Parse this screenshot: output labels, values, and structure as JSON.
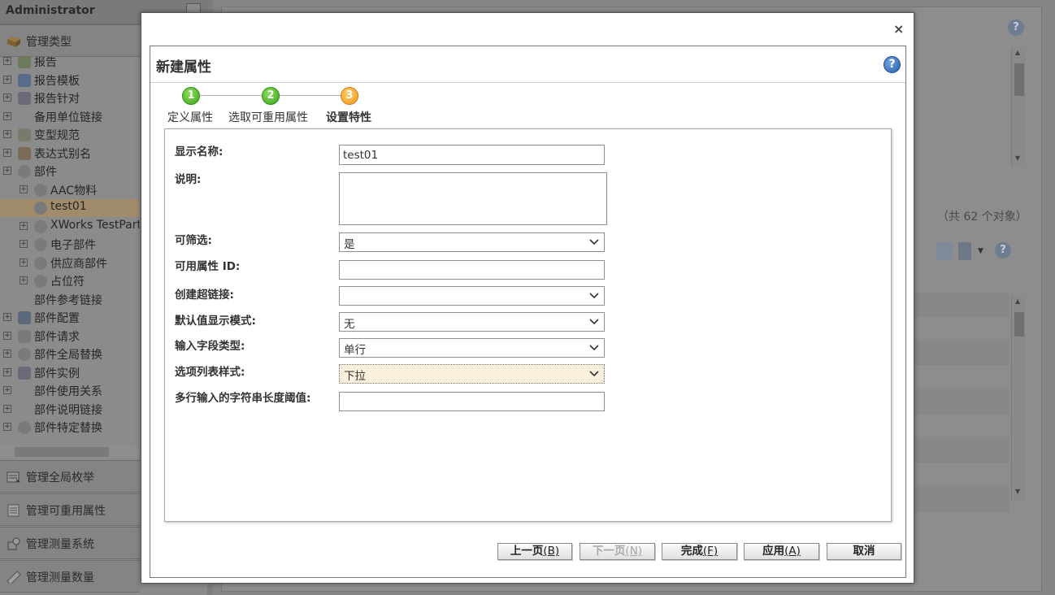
{
  "sidebar": {
    "title": "Administrator",
    "sections": {
      "manage_types": "管理类型",
      "manage_enums": "管理全局枚举",
      "manage_reusable": "管理可重用属性",
      "manage_measure_systems": "管理测量系统",
      "manage_quantities": "管理测量数量"
    },
    "tree": [
      {
        "label": "报告",
        "indent": 0,
        "expander": true,
        "icon": "report-icon"
      },
      {
        "label": "报告模板",
        "indent": 0,
        "expander": true,
        "icon": "report-template-icon"
      },
      {
        "label": "报告针对",
        "indent": 0,
        "expander": true,
        "icon": "report-target-icon"
      },
      {
        "label": "备用单位链接",
        "indent": 0,
        "expander": true,
        "icon": ""
      },
      {
        "label": "变型规范",
        "indent": 0,
        "expander": true,
        "icon": "variant-spec-icon"
      },
      {
        "label": "表达式别名",
        "indent": 0,
        "expander": true,
        "icon": "expression-alias-icon"
      },
      {
        "label": "部件",
        "indent": 0,
        "expander": true,
        "icon": "gear-icon"
      },
      {
        "label": "AAC物料",
        "indent": 1,
        "expander": true,
        "icon": "gear-icon"
      },
      {
        "label": "test01",
        "indent": 1,
        "expander": false,
        "icon": "gear-icon"
      },
      {
        "label": "XWorks TestPart",
        "indent": 1,
        "expander": true,
        "icon": "gear-icon"
      },
      {
        "label": "电子部件",
        "indent": 1,
        "expander": true,
        "icon": "gear-icon"
      },
      {
        "label": "供应商部件",
        "indent": 1,
        "expander": true,
        "icon": "gear-icon"
      },
      {
        "label": "占位符",
        "indent": 1,
        "expander": true,
        "icon": "gear-icon"
      },
      {
        "label": "部件参考链接",
        "indent": 0,
        "expander": false,
        "icon": ""
      },
      {
        "label": "部件配置",
        "indent": 0,
        "expander": true,
        "icon": "part-config-icon"
      },
      {
        "label": "部件请求",
        "indent": 0,
        "expander": true,
        "icon": "part-request-icon"
      },
      {
        "label": "部件全局替换",
        "indent": 0,
        "expander": true,
        "icon": "gear-icon"
      },
      {
        "label": "部件实例",
        "indent": 0,
        "expander": true,
        "icon": "part-instance-icon"
      },
      {
        "label": "部件使用关系",
        "indent": 0,
        "expander": true,
        "icon": ""
      },
      {
        "label": "部件说明链接",
        "indent": 0,
        "expander": true,
        "icon": ""
      },
      {
        "label": "部件特定替换",
        "indent": 0,
        "expander": true,
        "icon": "gear-icon"
      }
    ]
  },
  "main": {
    "count_text": "（共 62 个对象）"
  },
  "dialog": {
    "close_label": "×",
    "title": "新建属性",
    "help_label": "?",
    "steps": [
      {
        "num": "1",
        "label": "定义属性",
        "state": "done"
      },
      {
        "num": "2",
        "label": "选取可重用属性",
        "state": "done"
      },
      {
        "num": "3",
        "label": "设置特性",
        "state": "active"
      }
    ],
    "form": {
      "display_name_label": "显示名称:",
      "display_name_value": "test01",
      "description_label": "说明:",
      "filterable_label": "可筛选:",
      "filterable_value": "是",
      "attr_id_label": "可用属性 ID:",
      "attr_id_value": "",
      "hyperlink_label": "创建超链接:",
      "hyperlink_value": "",
      "default_mode_label": "默认值显示模式:",
      "default_mode_value": "无",
      "input_type_label": "输入字段类型:",
      "input_type_value": "单行",
      "list_style_label": "选项列表样式:",
      "list_style_value": "下拉",
      "multiline_threshold_label": "多行输入的字符串长度阈值:",
      "multiline_threshold_value": ""
    },
    "buttons": {
      "prev": "上一页",
      "prev_key": "(B)",
      "next": "下一页",
      "next_key": "(N)",
      "finish": "完成",
      "finish_key": "(F)",
      "apply": "应用",
      "apply_key": "(A)",
      "cancel": "取消"
    }
  },
  "colors": {
    "step_done": "#3aa51c",
    "step_active": "#f09a1b",
    "highlight_field": "#fcefdc"
  }
}
